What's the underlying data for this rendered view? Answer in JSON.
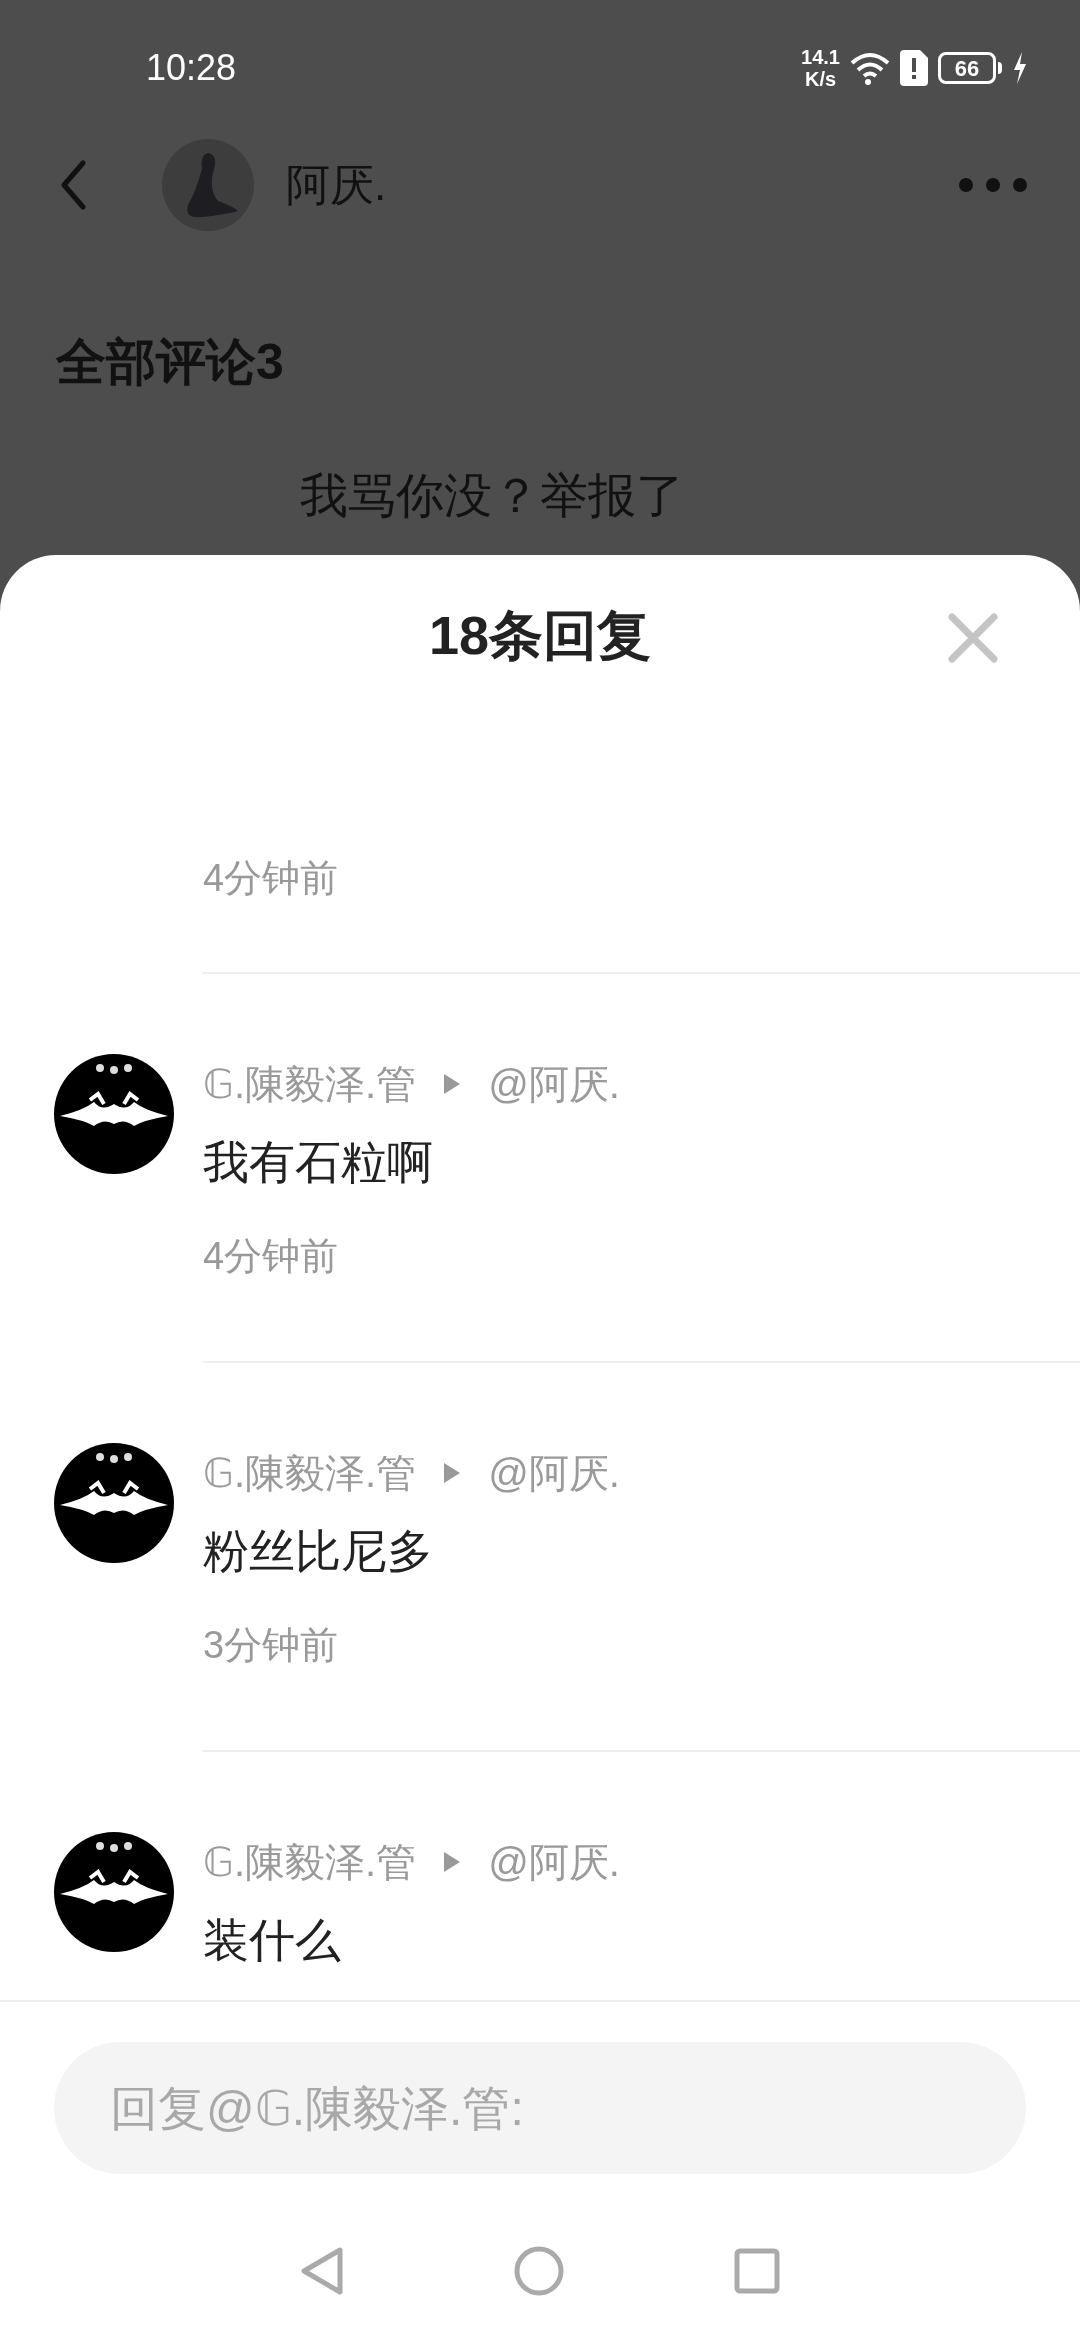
{
  "status_bar": {
    "time": "10:28",
    "speed_value": "14.1",
    "speed_unit": "K/s",
    "battery": "66"
  },
  "header": {
    "author": "阿厌."
  },
  "background": {
    "section_title": "全部评论3",
    "comment": "我骂你没？举报了"
  },
  "sheet": {
    "title": "18条回复",
    "replies": [
      {
        "kind": "partial",
        "time": "4分钟前"
      },
      {
        "kind": "full",
        "author": "𝔾.陳毅泽.管",
        "reply_to": "@阿厌.",
        "text": "我有石粒啊",
        "time": "4分钟前"
      },
      {
        "kind": "full",
        "author": "𝔾.陳毅泽.管",
        "reply_to": "@阿厌.",
        "text": "粉丝比尼多",
        "time": "3分钟前"
      },
      {
        "kind": "full",
        "author": "𝔾.陳毅泽.管",
        "reply_to": "@阿厌.",
        "text": "装什么"
      }
    ],
    "input": {
      "placeholder": "回复@𝔾.陳毅泽.管:"
    }
  }
}
